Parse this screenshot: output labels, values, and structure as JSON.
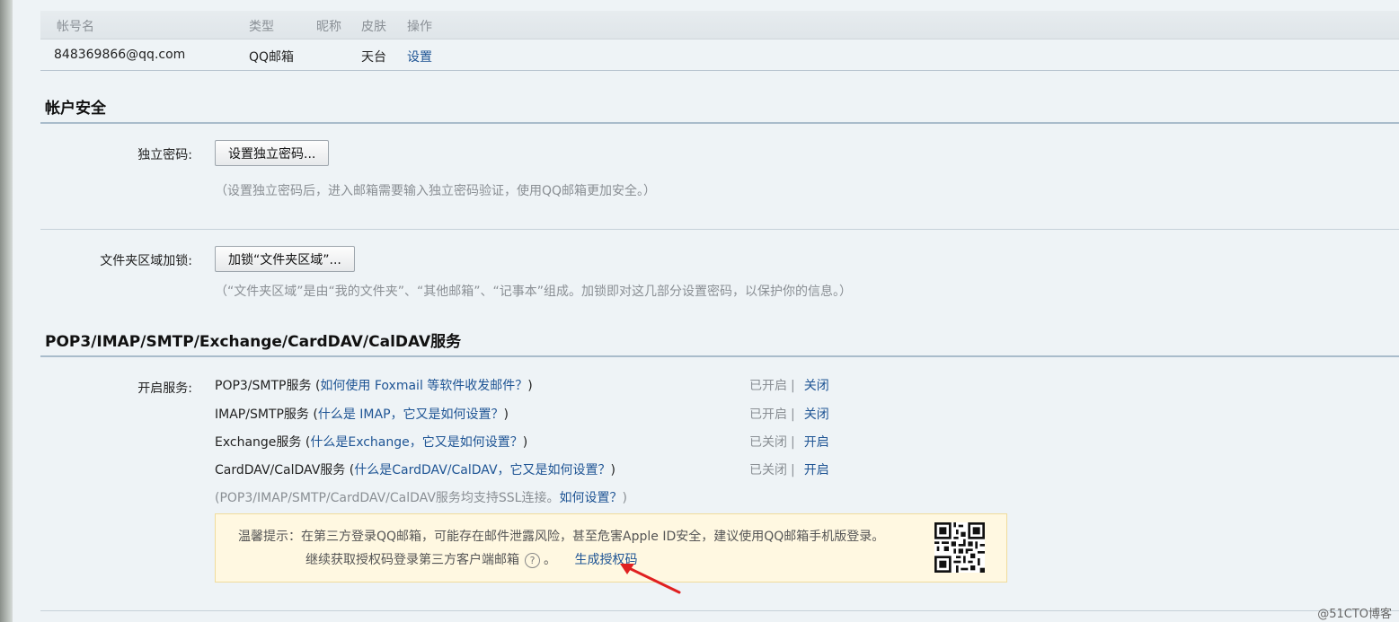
{
  "table": {
    "headers": [
      "帐号名",
      "类型",
      "昵称",
      "皮肤",
      "操作"
    ],
    "row": {
      "account": "848369866@qq.com",
      "type": "QQ邮箱",
      "nickname": "",
      "skin": "天台",
      "action": "设置"
    }
  },
  "security": {
    "title": "帐户安全",
    "independent_password": {
      "label": "独立密码:",
      "button": "设置独立密码...",
      "hint": "（设置独立密码后，进入邮箱需要输入独立密码验证，使用QQ邮箱更加安全。）"
    },
    "folder_lock": {
      "label": "文件夹区域加锁:",
      "button": "加锁“文件夹区域”...",
      "hint": "（“文件夹区域”是由“我的文件夹”、“其他邮箱”、“记事本”组成。加锁即对这几部分设置密码，以保护你的信息。）"
    }
  },
  "services": {
    "title": "POP3/IMAP/SMTP/Exchange/CardDAV/CalDAV服务",
    "label": "开启服务:",
    "items": [
      {
        "name": "POP3/SMTP服务",
        "help": "如何使用 Foxmail 等软件收发邮件？",
        "status": "已开启",
        "action": "关闭"
      },
      {
        "name": "IMAP/SMTP服务",
        "help": "什么是 IMAP，它又是如何设置？",
        "status": "已开启",
        "action": "关闭"
      },
      {
        "name": "Exchange服务",
        "help": "什么是Exchange，它又是如何设置？",
        "status": "已关闭",
        "action": "开启"
      },
      {
        "name": "CardDAV/CalDAV服务",
        "help": "什么是CardDAV/CalDAV，它又是如何设置？",
        "status": "已关闭",
        "action": "开启"
      }
    ],
    "ssl_hint_prefix": "(POP3/IMAP/SMTP/CardDAV/CalDAV服务均支持SSL连接。",
    "ssl_hint_link": "如何设置？",
    "ssl_hint_suffix": ")"
  },
  "notice": {
    "line1": "温馨提示：在第三方登录QQ邮箱，可能存在邮件泄露风险，甚至危害Apple ID安全，建议使用QQ邮箱手机版登录。",
    "line2_text": "继续获取授权码登录第三方客户端邮箱",
    "line2_period": "。",
    "generate_link": "生成授权码"
  },
  "watermark": "@51CTO博客",
  "colors": {
    "link": "#1e5494",
    "notice_bg": "#fff8e1",
    "arrow": "#e02020"
  }
}
